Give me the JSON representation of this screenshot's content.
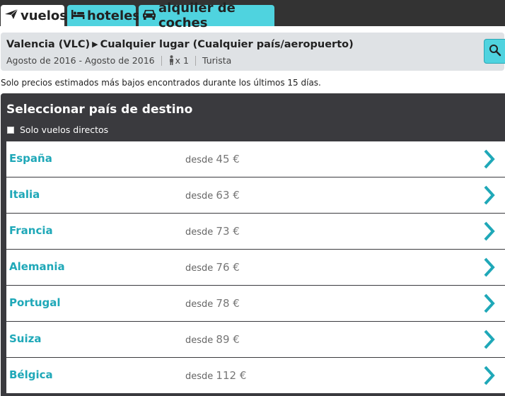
{
  "tabs": {
    "vuelos": "vuelos",
    "hoteles": "hoteles",
    "coches": "alquiler de coches"
  },
  "summary": {
    "origin": "Valencia (VLC)",
    "destination": "Cualquier lugar (Cualquier país/aeropuerto)",
    "dates": "Agosto de 2016 - Agosto de 2016",
    "passengers": "x 1",
    "cabin": "Turista"
  },
  "note": "Solo precios estimados más bajos encontrados durante los últimos 15 días.",
  "panel": {
    "title": "Seleccionar país de destino",
    "direct_only": "Solo vuelos directos"
  },
  "results": [
    {
      "country": "España",
      "from": "desde",
      "price": "45 €"
    },
    {
      "country": "Italia",
      "from": "desde",
      "price": "63 €"
    },
    {
      "country": "Francia",
      "from": "desde",
      "price": "73 €"
    },
    {
      "country": "Alemania",
      "from": "desde",
      "price": "76 €"
    },
    {
      "country": "Portugal",
      "from": "desde",
      "price": "78 €"
    },
    {
      "country": "Suiza",
      "from": "desde",
      "price": "89 €"
    },
    {
      "country": "Bélgica",
      "from": "desde",
      "price": "112 €"
    }
  ],
  "colors": {
    "accent": "#4fd3df",
    "link": "#1fa8b8",
    "topbar": "#333333",
    "panel": "#3a3a3e"
  },
  "icons": [
    "plane-icon",
    "bed-icon",
    "car-icon",
    "search-icon",
    "passenger-icon",
    "chevron-right-icon"
  ]
}
